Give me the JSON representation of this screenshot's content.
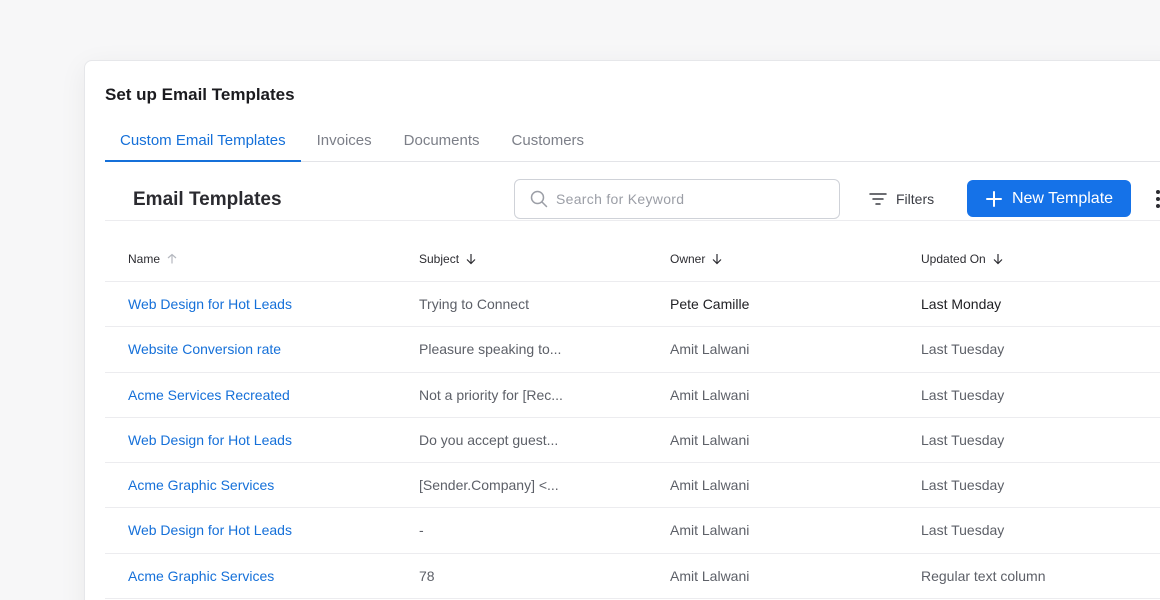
{
  "page_title": "Set up Email Templates",
  "tabs": [
    {
      "label": "Custom Email Templates",
      "active": true
    },
    {
      "label": "Invoices",
      "active": false
    },
    {
      "label": "Documents",
      "active": false
    },
    {
      "label": "Customers",
      "active": false
    }
  ],
  "section": {
    "title": "Email Templates",
    "search_placeholder": "Search for Keyword",
    "filters_label": "Filters",
    "new_button_label": "New Template"
  },
  "table": {
    "columns": [
      "Name",
      "Subject",
      "Owner",
      "Updated On"
    ],
    "rows": [
      {
        "name": "Web Design for Hot Leads",
        "subject": "Trying to Connect",
        "owner": "Pete Camille",
        "updated": "Last Monday"
      },
      {
        "name": "Website Conversion rate",
        "subject": "Pleasure speaking to...",
        "owner": "Amit Lalwani",
        "updated": "Last Tuesday"
      },
      {
        "name": "Acme Services Recreated",
        "subject": "Not a priority for [Rec...",
        "owner": "Amit Lalwani",
        "updated": "Last Tuesday"
      },
      {
        "name": "Web Design for Hot Leads",
        "subject": "Do you accept guest...",
        "owner": "Amit Lalwani",
        "updated": "Last Tuesday"
      },
      {
        "name": "Acme Graphic Services",
        "subject": "[Sender.Company] <...",
        "owner": "Amit Lalwani",
        "updated": "Last Tuesday"
      },
      {
        "name": "Web Design for Hot Leads",
        "subject": "-",
        "owner": "Amit Lalwani",
        "updated": "Last Tuesday"
      },
      {
        "name": "Acme Graphic Services",
        "subject": "78",
        "owner": "Amit Lalwani",
        "updated": "Regular text column"
      }
    ]
  },
  "colors": {
    "accent": "#1570d9",
    "button": "#1572e8",
    "muted_text": "#5d6068"
  },
  "icons": {
    "search": "search-icon",
    "filters": "filter-icon",
    "new": "plus-icon",
    "more": "kebab-menu-icon",
    "sort_up": "arrow-up-icon",
    "sort_down": "arrow-down-icon"
  }
}
